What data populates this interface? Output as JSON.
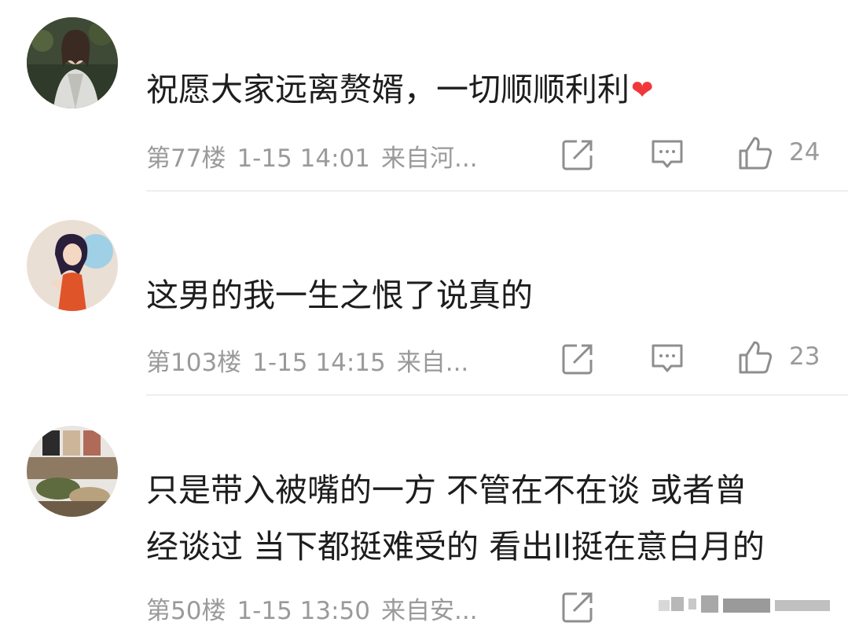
{
  "comments": [
    {
      "text": "祝愿大家远离赘婿，一切顺顺利利",
      "floor": "第77楼",
      "time": "1-15 14:01",
      "source": "来自河...",
      "likes": "24",
      "has_heart": true
    },
    {
      "text": "这男的我一生之恨了说真的",
      "floor": "第103楼",
      "time": "1-15 14:15",
      "source": "来自...",
      "likes": "23"
    },
    {
      "text_line1": "只是带入被嘴的一方 不管在不在谈 或者曾",
      "text_line2": "经谈过 当下都挺难受的 看出ll挺在意白月的",
      "floor": "第50楼",
      "time": "1-15 13:50",
      "source": "来自安..."
    }
  ],
  "colors": {
    "text": "#1d1d1d",
    "meta": "#9a9a9a",
    "heart": "#f0383a",
    "divider": "#eeeeee"
  },
  "icons": [
    "share-icon",
    "reply-icon",
    "like-icon",
    "heart-emoji"
  ]
}
